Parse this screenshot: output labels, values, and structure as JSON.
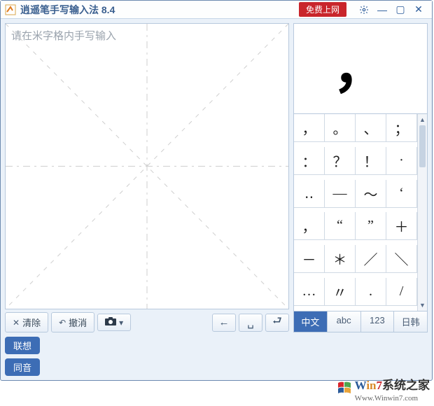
{
  "titlebar": {
    "app_name": "逍遥笔手写输入法",
    "version": "8.4",
    "badge": "免费上网"
  },
  "writing": {
    "placeholder": "请在米字格内手写输入"
  },
  "toolbar": {
    "clear": "清除",
    "undo": "撤消"
  },
  "candidate_preview": "，",
  "candidates": [
    "，",
    "。",
    "、",
    "；",
    "：",
    "？",
    "！",
    "·",
    "‥",
    "—",
    "～",
    "‘",
    "，",
    "“",
    "”",
    "＋",
    "－",
    "＊",
    "／",
    "＼",
    "…",
    "〃",
    ".",
    "/"
  ],
  "mode_tabs": [
    "中文",
    "abc",
    "123",
    "日韩"
  ],
  "active_mode": 0,
  "bottom_pills": [
    "联想",
    "同音"
  ],
  "watermark": {
    "brand": "Win7系统之家",
    "url": "Www.Winwin7.com"
  }
}
